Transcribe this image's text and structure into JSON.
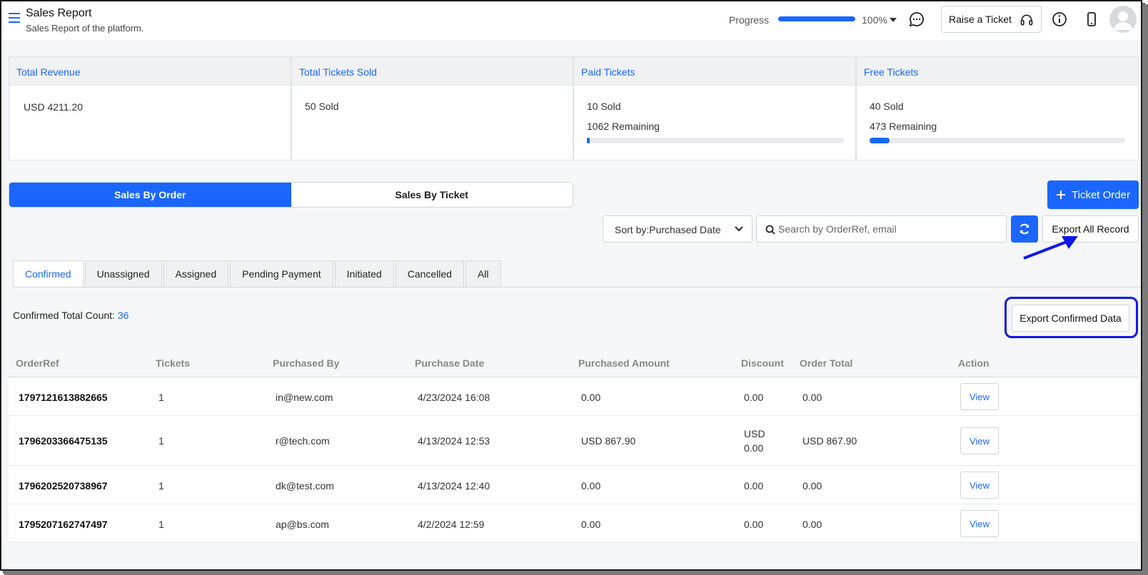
{
  "header": {
    "title": "Sales Report",
    "subtitle": "Sales Report of the platform.",
    "progress_label": "Progress",
    "progress_value": "100%",
    "progress_fraction": 1.0,
    "raise_ticket_label": "Raise a Ticket"
  },
  "stats": [
    {
      "title": "Total Revenue",
      "lines": [
        "USD 4211.20"
      ],
      "bar": null
    },
    {
      "title": "Total Tickets Sold",
      "lines": [
        "50 Sold"
      ],
      "bar": null
    },
    {
      "title": "Paid Tickets",
      "lines": [
        "10 Sold",
        "1062 Remaining"
      ],
      "bar": 0.009
    },
    {
      "title": "Free Tickets",
      "lines": [
        "40 Sold",
        "473 Remaining"
      ],
      "bar": 0.078
    }
  ],
  "segments": {
    "sales_by_order": "Sales By Order",
    "sales_by_ticket": "Sales By Ticket"
  },
  "toolbar": {
    "ticket_order_label": "Ticket Order",
    "sort_label": "Sort by:Purchased Date",
    "search_placeholder": "Search by OrderRef, email",
    "export_all_label": "Export All Record",
    "export_confirmed_label": "Export Confirmed Data"
  },
  "tabs": [
    "Confirmed",
    "Unassigned",
    "Assigned",
    "Pending Payment",
    "Initiated",
    "Cancelled",
    "All"
  ],
  "count": {
    "label": "Confirmed Total Count: ",
    "value": "36"
  },
  "table": {
    "columns": [
      "OrderRef",
      "Tickets",
      "Purchased By",
      "Purchase Date",
      "Purchased Amount",
      "Discount",
      "Order Total",
      "Action"
    ],
    "rows": [
      {
        "ref": "1797121613882665",
        "tickets": "1",
        "by": "in@new.com",
        "date": "4/23/2024 16:08",
        "amount": "0.00",
        "discount": "0.00",
        "total": "0.00",
        "action": "View"
      },
      {
        "ref": "1796203366475135",
        "tickets": "1",
        "by": "r@tech.com",
        "date": "4/13/2024 12:53",
        "amount": "USD 867.90",
        "discount_line1": "USD",
        "discount_line2": "0.00",
        "total": "USD 867.90",
        "action": "View"
      },
      {
        "ref": "1796202520738967",
        "tickets": "1",
        "by": "dk@test.com",
        "date": "4/13/2024 12:40",
        "amount": "0.00",
        "discount": "0.00",
        "total": "0.00",
        "action": "View"
      },
      {
        "ref": "1795207162747497",
        "tickets": "1",
        "by": "ap@bs.com",
        "date": "4/2/2024 12:59",
        "amount": "0.00",
        "discount": "0.00",
        "total": "0.00",
        "action": "View"
      }
    ]
  },
  "colors": {
    "accent": "#1a66ff",
    "annotation": "#1018e8"
  }
}
